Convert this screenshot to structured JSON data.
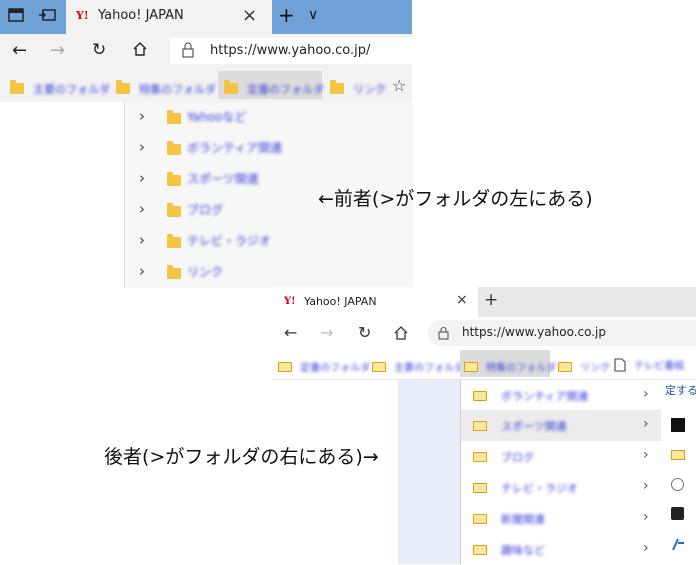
{
  "top_browser": {
    "tab_title": "Yahoo! JAPAN",
    "tab_close": "×",
    "new_tab": "+",
    "tab_menu": "∨",
    "url": "https://www.yahoo.co.jp/",
    "favorites": [
      {
        "label": "主要のフォルダ"
      },
      {
        "label": "特集のフォルダ"
      },
      {
        "label": "定番のフォルダ"
      },
      {
        "label": "リンク"
      }
    ],
    "dropdown": [
      {
        "label": "Yahooなど",
        "w": 80
      },
      {
        "label": "ボランティア関連",
        "w": 92
      },
      {
        "label": "スポーツ関連",
        "w": 70
      },
      {
        "label": "ブログ",
        "w": 38
      },
      {
        "label": "テレビ・ラジオ",
        "w": 74
      },
      {
        "label": "リンク",
        "w": 36
      }
    ],
    "dropdown_chevron": "›"
  },
  "bottom_browser": {
    "tab_title": "Yahoo! JAPAN",
    "tab_close": "×",
    "new_tab": "+",
    "url": "https://www.yahoo.co.jp",
    "favorites": [
      {
        "label": "定番のフォルダ"
      },
      {
        "label": "主要のフォルダ"
      },
      {
        "label": "特集のフォルダ"
      },
      {
        "label": "リンク"
      },
      {
        "label": "テレビ番組"
      }
    ],
    "dropdown": [
      {
        "label": "ボランティア関連",
        "w": 90
      },
      {
        "label": "スポーツ関連",
        "w": 72
      },
      {
        "label": "ブログ",
        "w": 50
      },
      {
        "label": "テレビ・ラジオ",
        "w": 66
      },
      {
        "label": "新聞関連",
        "w": 52
      },
      {
        "label": "趣味など",
        "w": 46
      }
    ],
    "dropdown_chevron": "›",
    "side_text": "定する"
  },
  "captions": {
    "former": "←前者(>がフォルダの左にある)",
    "latter": "後者(>がフォルダの右にある)→"
  },
  "colors": {
    "edge_old_tabbar": "#6fa3d7",
    "folder_yellow": "#f4c542",
    "scribble_blue": "#3f45d6"
  }
}
